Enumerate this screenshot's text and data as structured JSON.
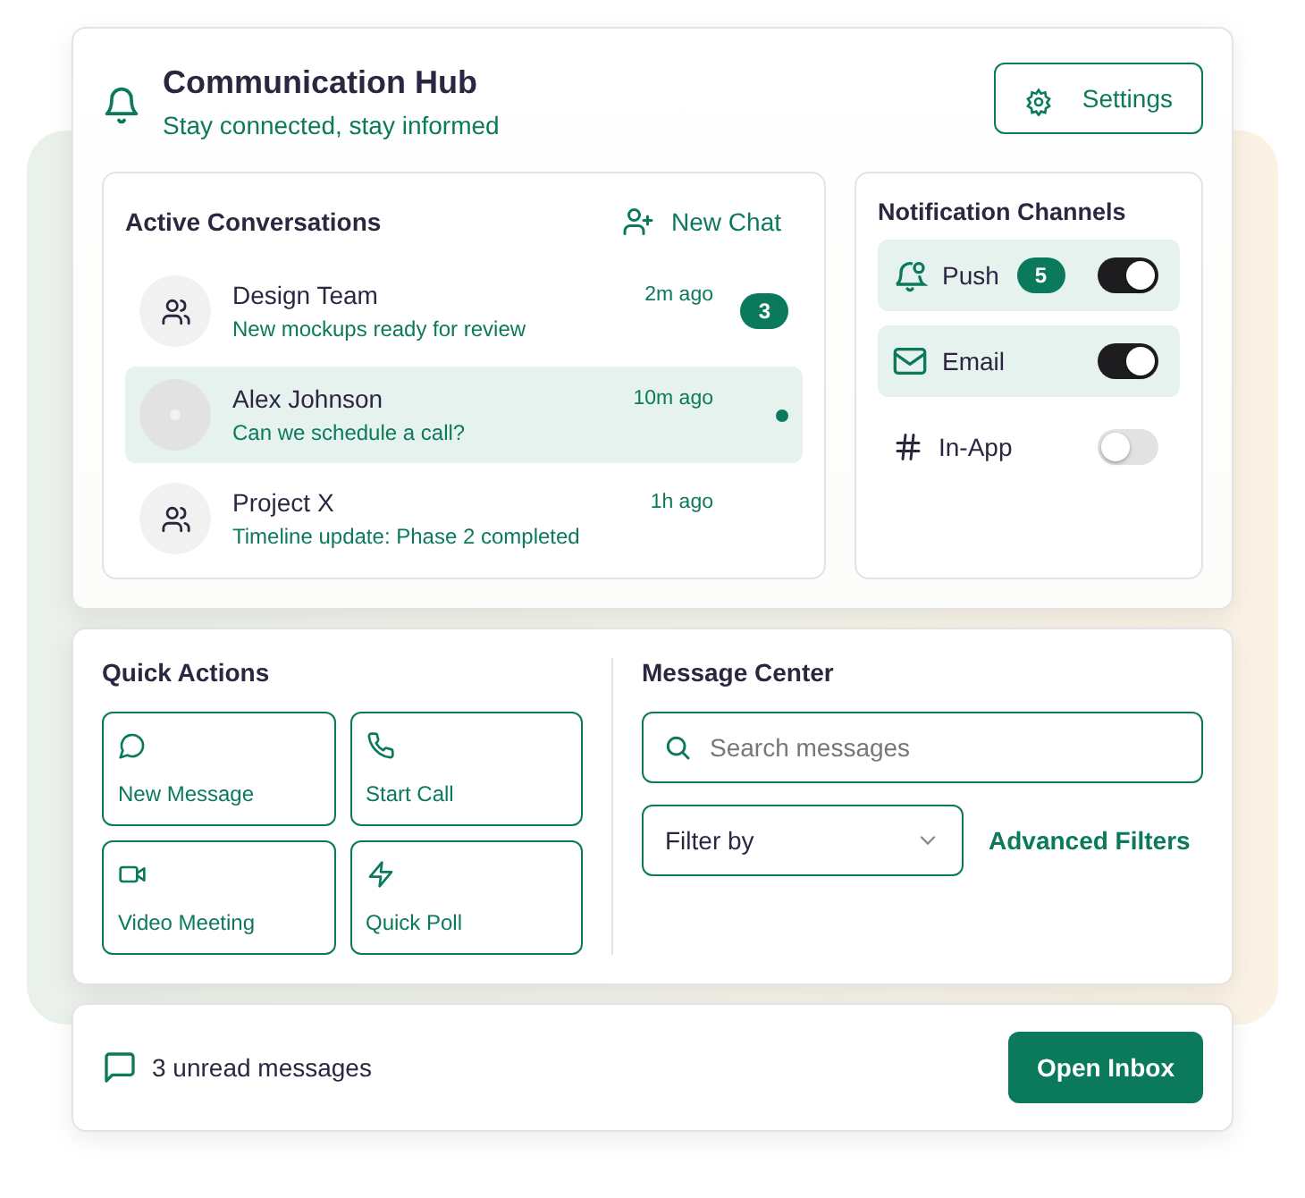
{
  "header": {
    "title": "Communication Hub",
    "subtitle": "Stay connected, stay informed",
    "settings_button": "Settings"
  },
  "conversations": {
    "title": "Active Conversations",
    "new_chat": "New Chat",
    "items": [
      {
        "kind": "group",
        "name": "Design Team",
        "message": "New mockups ready for review",
        "time": "2m ago",
        "unread": "3",
        "selected": false,
        "online": false
      },
      {
        "kind": "person",
        "name": "Alex Johnson",
        "message": "Can we schedule a call?",
        "time": "10m ago",
        "selected": true,
        "online": true
      },
      {
        "kind": "group",
        "name": "Project X",
        "message": "Timeline update: Phase 2 completed",
        "time": "1h ago",
        "selected": false,
        "online": false
      }
    ]
  },
  "channels": {
    "title": "Notification Channels",
    "items": [
      {
        "kind": "push",
        "label": "Push",
        "count": "5",
        "on": true
      },
      {
        "kind": "email",
        "label": "Email",
        "on": true
      },
      {
        "kind": "inapp",
        "label": "In-App",
        "on": false
      }
    ]
  },
  "quick_actions": {
    "title": "Quick Actions",
    "items": [
      {
        "kind": "message",
        "label": "New Message"
      },
      {
        "kind": "call",
        "label": "Start Call"
      },
      {
        "kind": "video",
        "label": "Video Meeting"
      },
      {
        "kind": "poll",
        "label": "Quick Poll"
      }
    ]
  },
  "message_center": {
    "title": "Message Center",
    "search": {
      "placeholder": "Search messages"
    },
    "filter": {
      "value": "Filter by"
    },
    "advanced_filters": "Advanced Filters"
  },
  "footer": {
    "unread": "3 unread messages",
    "button": "Open Inbox"
  }
}
